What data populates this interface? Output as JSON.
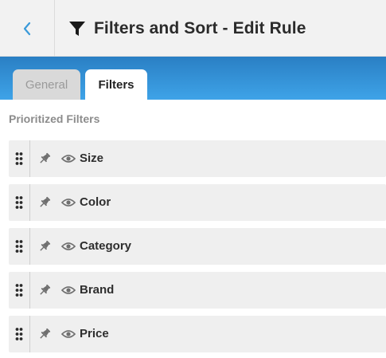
{
  "header": {
    "title": "Filters and Sort - Edit Rule",
    "back_icon": "chevron-left-icon",
    "title_icon": "funnel-icon",
    "accent_color": "#3a9ad9"
  },
  "tabs": [
    {
      "label": "General",
      "active": false
    },
    {
      "label": "Filters",
      "active": true
    }
  ],
  "section": {
    "title": "Prioritized Filters"
  },
  "filters": [
    {
      "label": "Size"
    },
    {
      "label": "Color"
    },
    {
      "label": "Category"
    },
    {
      "label": "Brand"
    },
    {
      "label": "Price"
    }
  ]
}
